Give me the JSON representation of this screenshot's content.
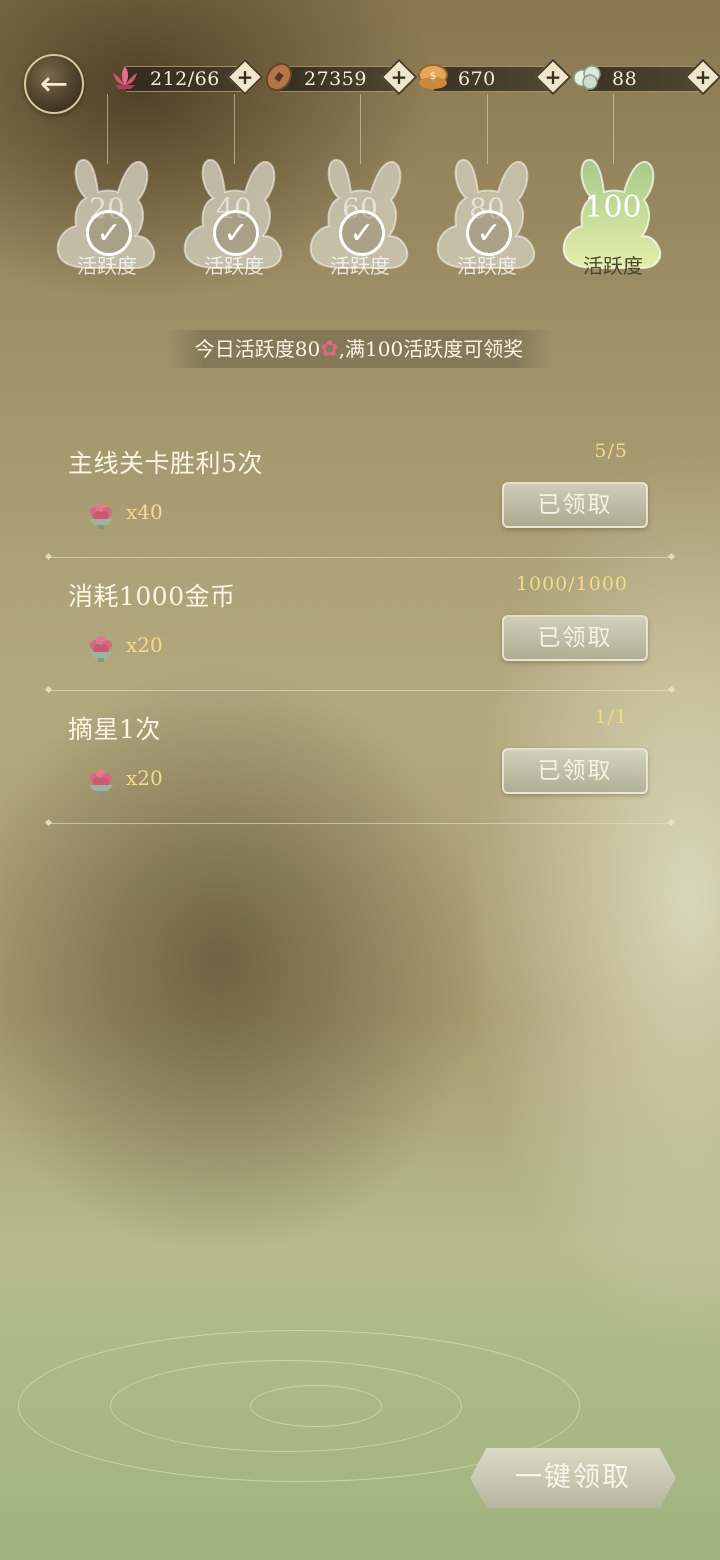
{
  "topbar": {
    "resources": [
      {
        "icon": "lotus-icon",
        "value": "212/66"
      },
      {
        "icon": "copper-coin-icon",
        "value": "27359"
      },
      {
        "icon": "gold-ingot-icon",
        "value": "670"
      },
      {
        "icon": "jade-orb-icon",
        "value": "88"
      }
    ],
    "plus_symbol": "+",
    "back_symbol": "←"
  },
  "milestones": [
    {
      "points": "20",
      "label": "活跃度",
      "claimed": true
    },
    {
      "points": "40",
      "label": "活跃度",
      "claimed": true
    },
    {
      "points": "60",
      "label": "活跃度",
      "claimed": true
    },
    {
      "points": "80",
      "label": "活跃度",
      "claimed": true
    },
    {
      "points": "100",
      "label": "活跃度",
      "claimed": false
    }
  ],
  "summary": {
    "prefix": "今日活跃度80",
    "suffix": ",满100活跃度可领奖"
  },
  "tasks": [
    {
      "name": "主线关卡胜利5次",
      "reward_qty": "x40",
      "progress": "5/5",
      "button": "已领取"
    },
    {
      "name": "消耗1000金币",
      "reward_qty": "x20",
      "progress": "1000/1000",
      "button": "已领取"
    },
    {
      "name": "摘星1次",
      "reward_qty": "x20",
      "progress": "1/1",
      "button": "已领取"
    }
  ],
  "claim_all": {
    "label": "一键领取"
  },
  "colors": {
    "accent_gold": "#f3d989",
    "active_milestone": "#d9e6a4"
  }
}
